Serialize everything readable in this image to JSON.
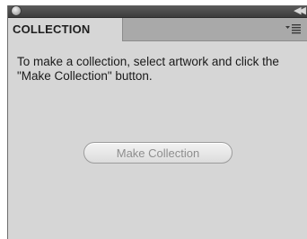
{
  "panel": {
    "tab_label": "COLLECTION",
    "instructions": "To make a collection, select artwork and click the \"Make Collection\" button.",
    "make_button_label": "Make Collection",
    "collapse_icon": "double-chevron-right-icon",
    "menu_icon": "panel-menu-icon",
    "close_icon": "close-icon"
  }
}
